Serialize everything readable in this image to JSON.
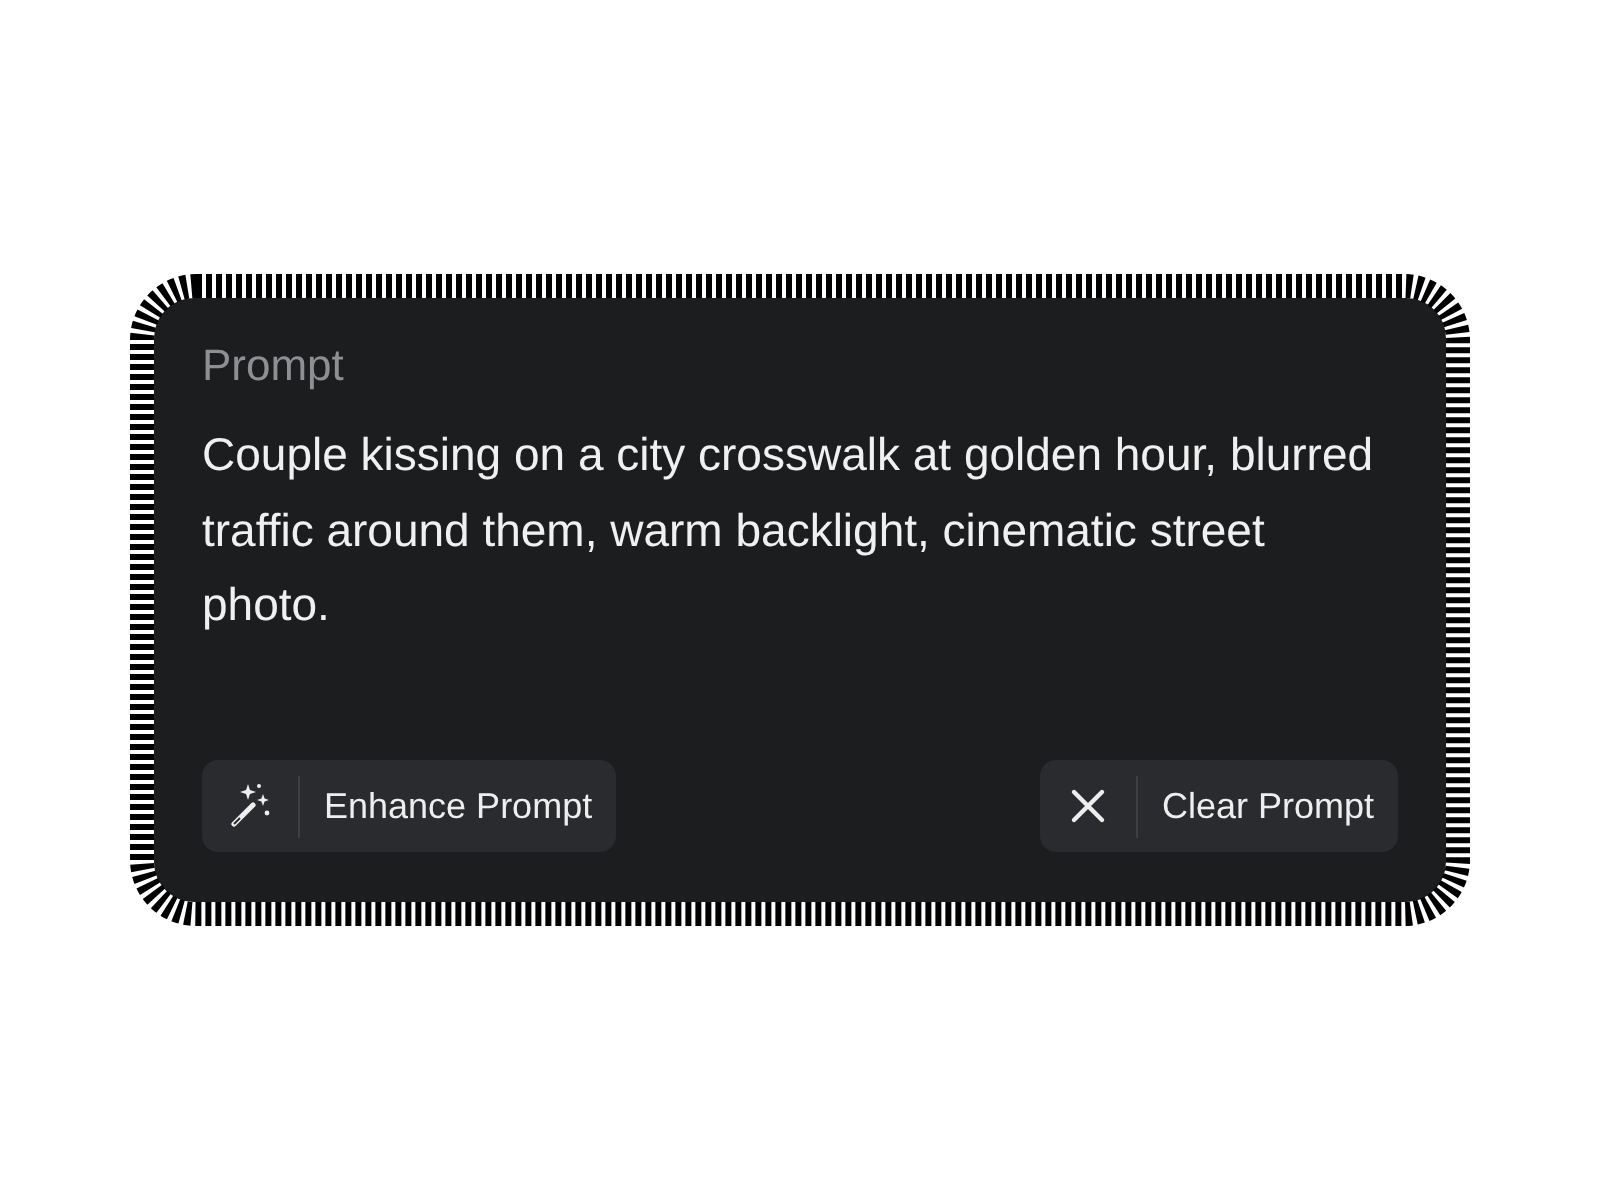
{
  "prompt": {
    "label": "Prompt",
    "text": "Couple kissing on a city crosswalk at golden hour, blurred traffic around them, warm backlight, cinematic street photo."
  },
  "buttons": [
    {
      "kind": "enhance",
      "label": "Enhance Prompt"
    },
    {
      "kind": "clear",
      "label": "Clear Prompt"
    }
  ]
}
